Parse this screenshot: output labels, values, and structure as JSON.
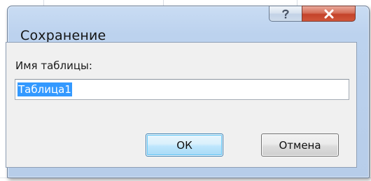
{
  "dialog": {
    "title": "Сохранение",
    "help_icon": "question-mark-icon",
    "close_icon": "close-x-icon",
    "field_label": "Имя таблицы:",
    "field_value": "Таблица1",
    "ok_label": "ОК",
    "cancel_label": "Отмена"
  },
  "colors": {
    "selection": "#3399ff",
    "close_button": "#c4432a",
    "frame": "#bcd2ee"
  }
}
